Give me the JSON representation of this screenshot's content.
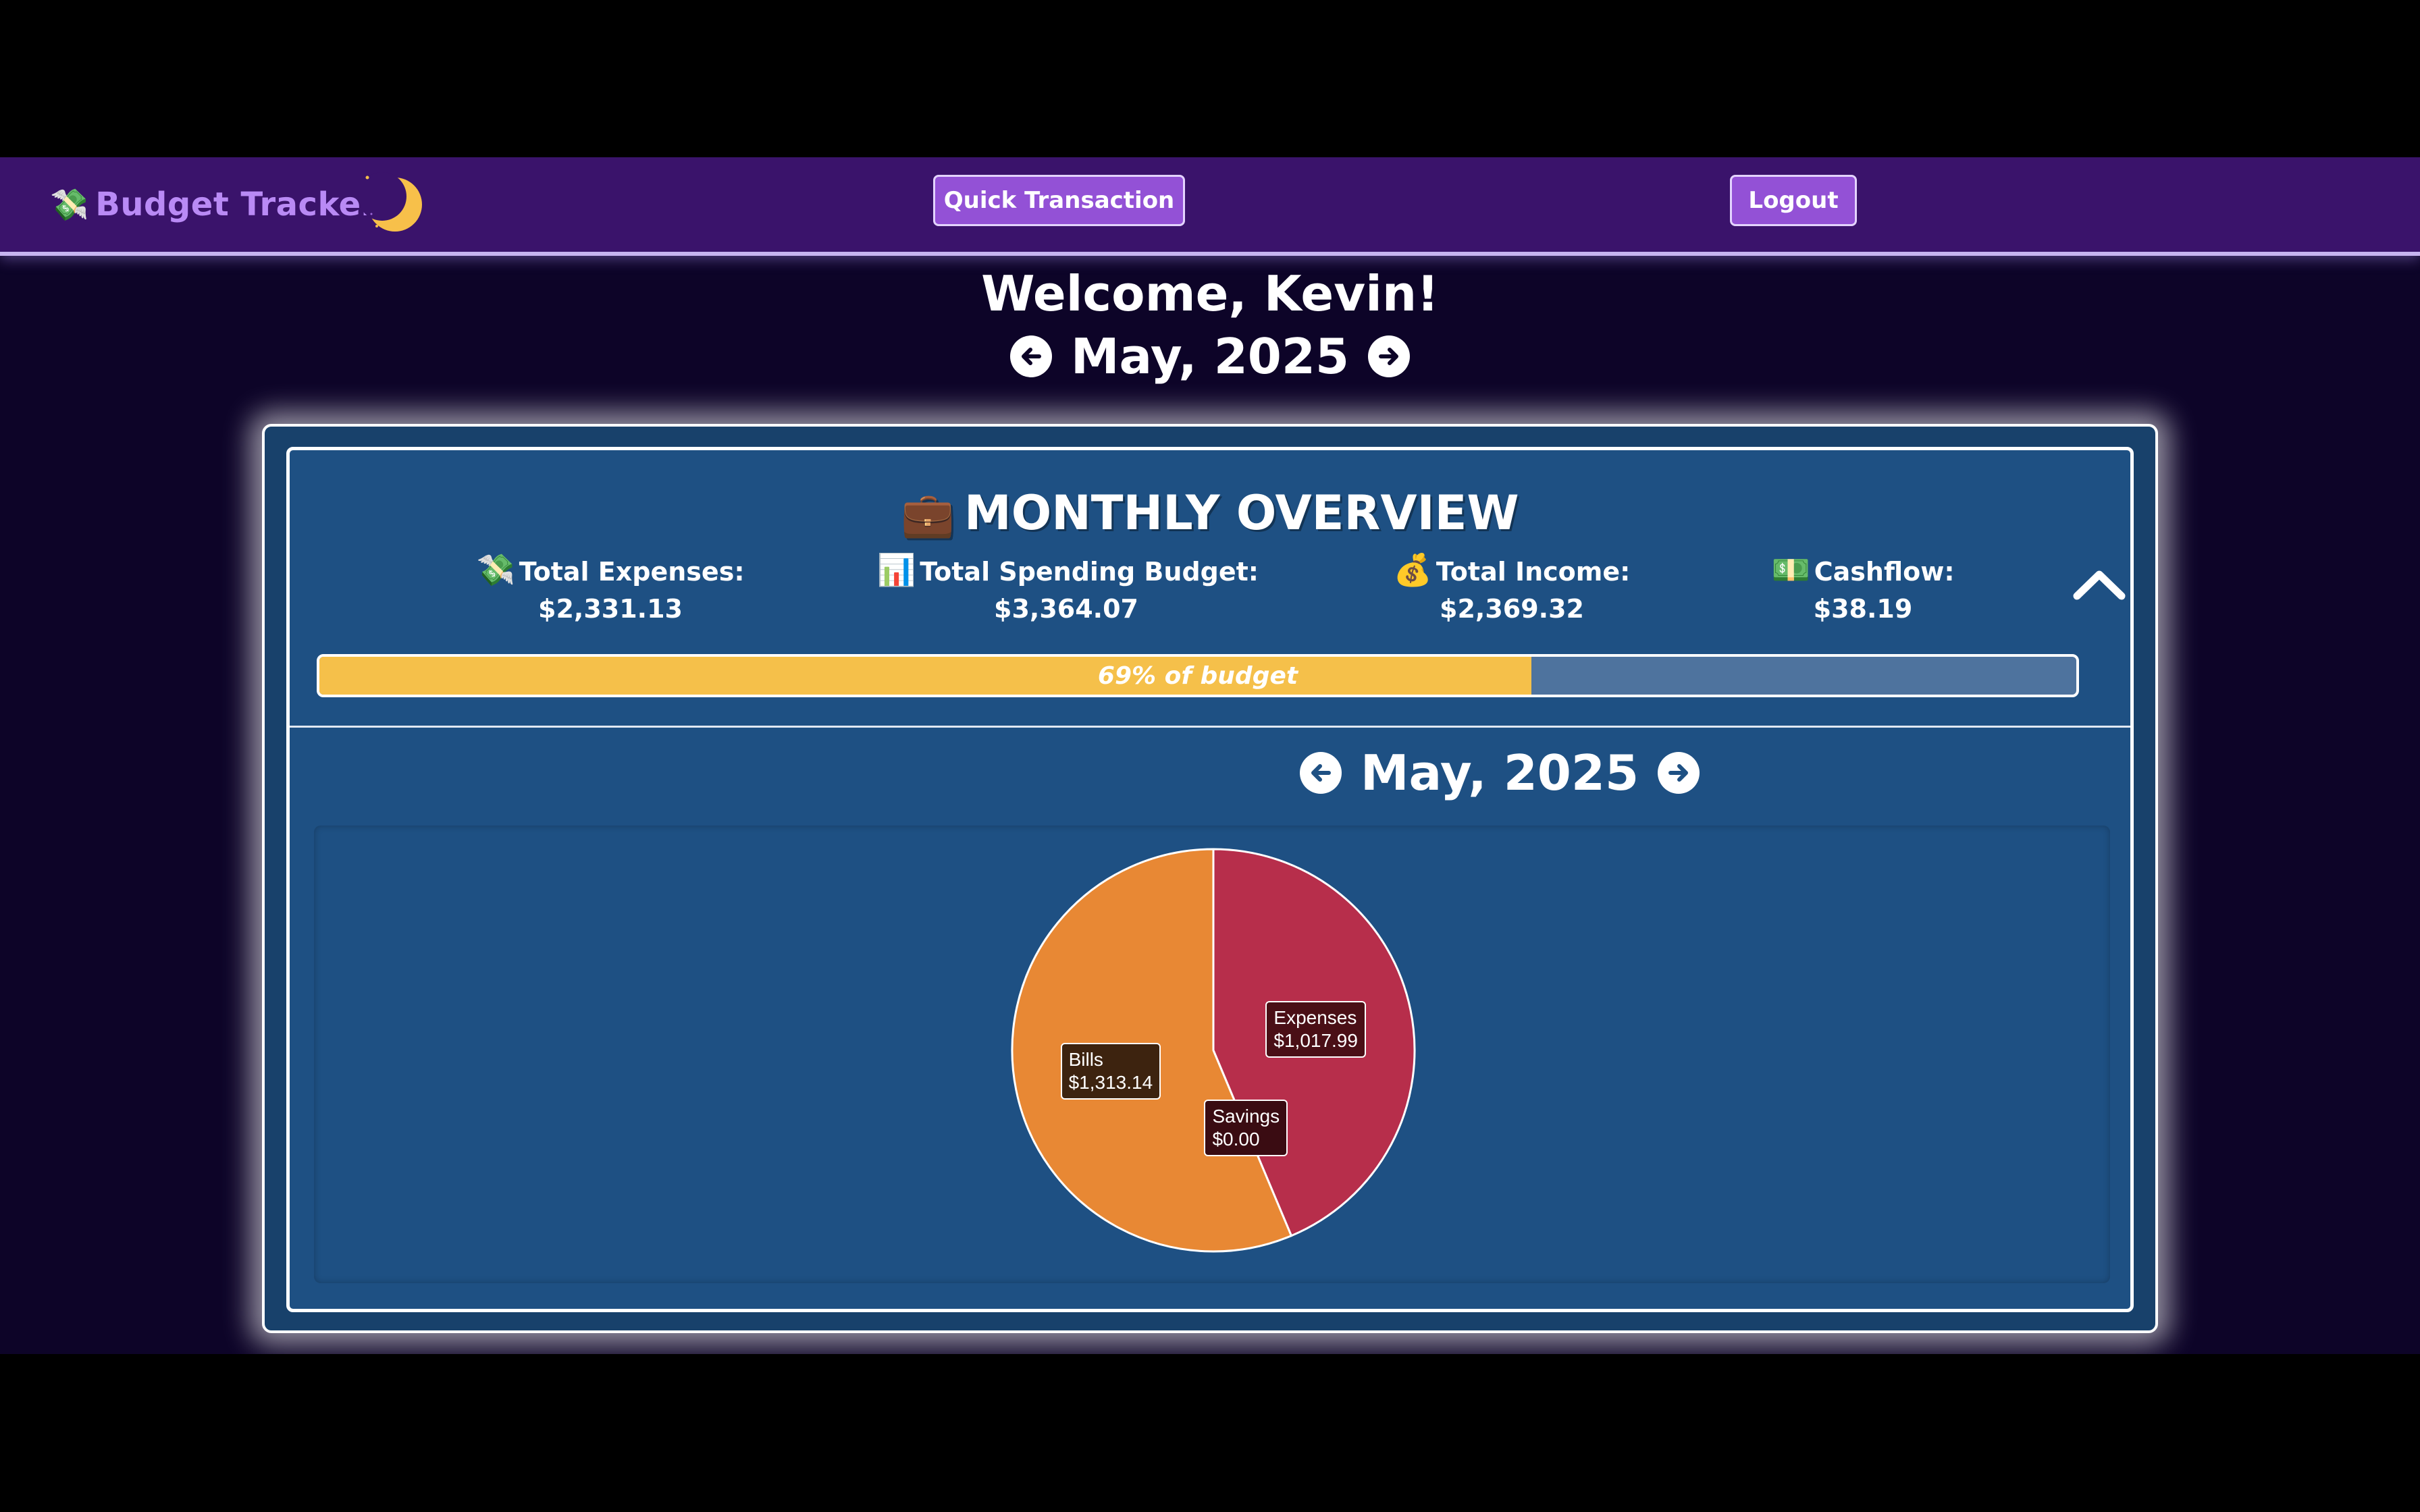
{
  "app": {
    "brand_icon": "💸",
    "brand_name": "Budget Tracker",
    "quick_transaction_label": "Quick Transaction",
    "logout_label": "Logout"
  },
  "header": {
    "welcome": "Welcome, Kevin!",
    "month": "May, 2025"
  },
  "overview": {
    "icon": "💼",
    "title": "MONTHLY OVERVIEW",
    "stats": {
      "expenses": {
        "icon": "💸",
        "label": "Total Expenses:",
        "value": "$2,331.13"
      },
      "budget": {
        "icon": "📊",
        "label": "Total Spending Budget:",
        "value": "$3,364.07"
      },
      "income": {
        "icon": "💰",
        "label": "Total Income:",
        "value": "$2,369.32"
      },
      "cashflow": {
        "icon": "💵",
        "label": "Cashflow:",
        "value": "$38.19"
      }
    },
    "progress": {
      "percent": 69,
      "label": "69% of budget"
    }
  },
  "chart_month": "May, 2025",
  "chart_data": {
    "type": "pie",
    "categories": [
      "Expenses",
      "Savings",
      "Bills"
    ],
    "values": [
      1017.99,
      0.0,
      1313.14
    ],
    "value_labels": [
      "$1,017.99",
      "$0.00",
      "$1,313.14"
    ],
    "colors": [
      "#b72e4b",
      "#a02a42",
      "#e88834"
    ],
    "label_bg": [
      "#4a0f16",
      "#3a0c12",
      "#3d230f"
    ]
  },
  "colors": {
    "navbar": "#3a136b",
    "accent_button": "#9351d6",
    "brand_text": "#b98af5",
    "card": "#1e5083",
    "progress_fill": "#f5c04a",
    "progress_track": "#4e739e",
    "moon": "#f7c04a"
  }
}
